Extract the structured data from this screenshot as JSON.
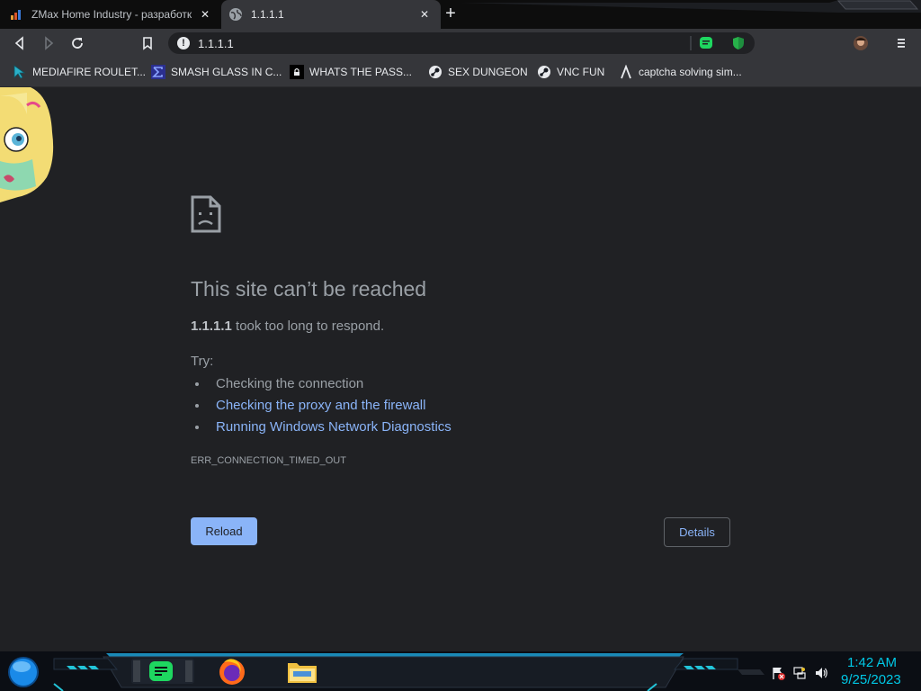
{
  "browser": {
    "tabs": [
      {
        "title": "ZMax Home Industry - разработк",
        "active": false
      },
      {
        "title": "1.1.1.1",
        "active": true
      }
    ],
    "address": "1.1.1.1",
    "bookmarks": [
      {
        "label": "MEDIAFIRE ROULET...",
        "icon": "arrow-cursor-icon"
      },
      {
        "label": "SMASH GLASS IN C...",
        "icon": "sigma-icon"
      },
      {
        "label": "WHATS THE PASS...",
        "icon": "lock-icon"
      },
      {
        "label": "SEX DUNGEON",
        "icon": "steam-icon"
      },
      {
        "label": "VNC FUN",
        "icon": "steam-icon"
      },
      {
        "label": "captcha solving sim...",
        "icon": "lambda-icon"
      }
    ]
  },
  "error_page": {
    "heading": "This site can’t be reached",
    "host": "1.1.1.1",
    "message_rest": " took too long to respond.",
    "try_label": "Try:",
    "suggestions": [
      "Checking the connection",
      "Checking the proxy and the firewall",
      "Running Windows Network Diagnostics"
    ],
    "error_code": "ERR_CONNECTION_TIMED_OUT",
    "reload_label": "Reload",
    "details_label": "Details"
  },
  "taskbar": {
    "time": "1:42 AM",
    "date": "9/25/2023"
  },
  "colors": {
    "link": "#8ab4f8",
    "text": "#9aa0a6",
    "background": "#202124",
    "clock": "#00c8e6"
  }
}
